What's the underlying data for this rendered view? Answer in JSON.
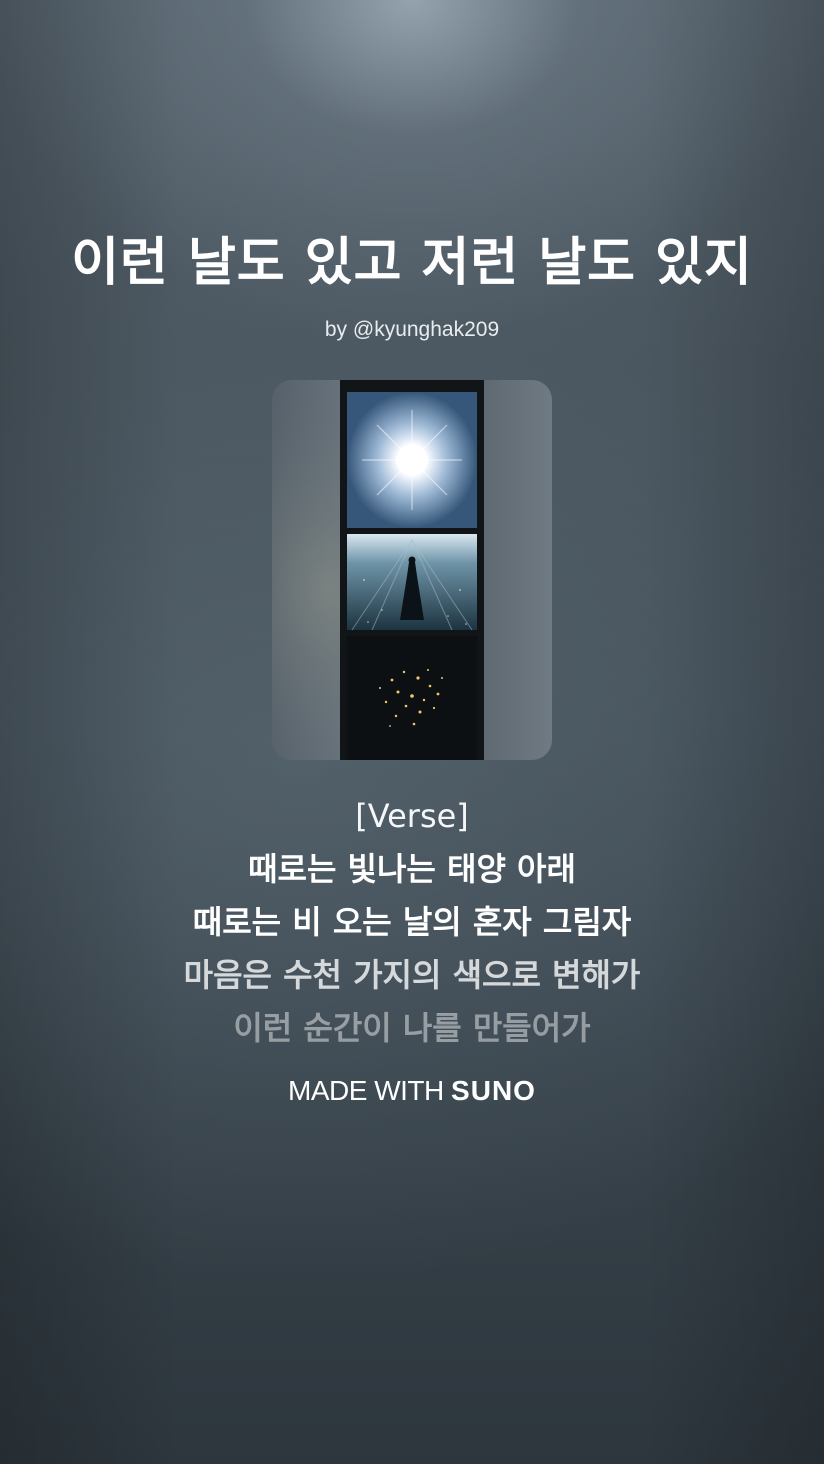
{
  "song": {
    "title": "이런 날도 있고 저런 날도 있지",
    "byline": "by @kyunghak209"
  },
  "cover_art": {
    "icon": "album-cover-image",
    "description_colors": {
      "sun_glow": "#ffffff",
      "panel_sky": "#5c7d97",
      "film_strip": "#131618",
      "sparkles": "#f2c66b"
    }
  },
  "lyrics": {
    "lines": [
      "[Verse]",
      "때로는 빛나는 태양 아래",
      "때로는 비 오는 날의 혼자 그림자",
      "마음은 수천 가지의 색으로 변해가",
      "이런 순간이 나를 만들어가"
    ]
  },
  "branding": {
    "prefix": "MADE WITH",
    "logo_text": "SUNO"
  },
  "colors": {
    "text_primary": "#ffffff",
    "background_top": "#8996a0",
    "background_bottom": "#2d363d"
  }
}
